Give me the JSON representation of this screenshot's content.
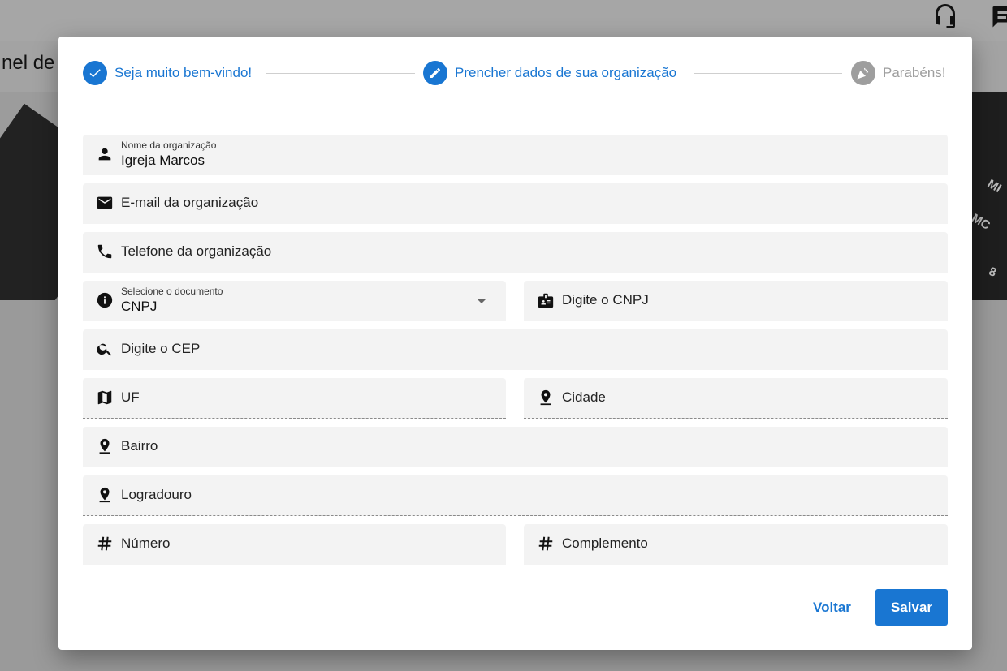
{
  "background": {
    "page_title_fragment": "nel de",
    "icons": [
      "headset-icon",
      "chat-icon"
    ],
    "keypad_keys": [
      "MI",
      "MC",
      "8"
    ]
  },
  "stepper": {
    "steps": [
      {
        "label": "Seja muito bem-vindo!",
        "state": "completed",
        "icon": "check-icon"
      },
      {
        "label": "Prencher dados de sua organização",
        "state": "active",
        "icon": "pencil-icon"
      },
      {
        "label": "Parabéns!",
        "state": "inactive",
        "icon": "party-popper-icon"
      }
    ]
  },
  "form": {
    "org_name": {
      "label": "Nome da organização",
      "value": "Igreja Marcos",
      "icon": "person-icon"
    },
    "org_email": {
      "placeholder": "E-mail da organização",
      "icon": "email-icon"
    },
    "org_phone": {
      "placeholder": "Telefone da organização",
      "icon": "phone-icon"
    },
    "document_type": {
      "label": "Selecione o documento",
      "value": "CNPJ",
      "icon": "info-icon"
    },
    "document_number": {
      "placeholder": "Digite o CNPJ",
      "icon": "badge-icon"
    },
    "cep": {
      "placeholder": "Digite o CEP",
      "icon": "search-icon"
    },
    "uf": {
      "placeholder": "UF",
      "icon": "map-icon"
    },
    "city": {
      "placeholder": "Cidade",
      "icon": "location-pin-icon"
    },
    "neighborhood": {
      "placeholder": "Bairro",
      "icon": "location-pin-icon"
    },
    "street": {
      "placeholder": "Logradouro",
      "icon": "location-pin-icon"
    },
    "number": {
      "placeholder": "Número",
      "icon": "hash-icon"
    },
    "complement": {
      "placeholder": "Complemento",
      "icon": "hash-icon"
    }
  },
  "actions": {
    "back_label": "Voltar",
    "save_label": "Salvar"
  },
  "colors": {
    "primary": "#1976d2",
    "inactive": "#9e9e9e",
    "field_bg": "#f3f3f3"
  }
}
